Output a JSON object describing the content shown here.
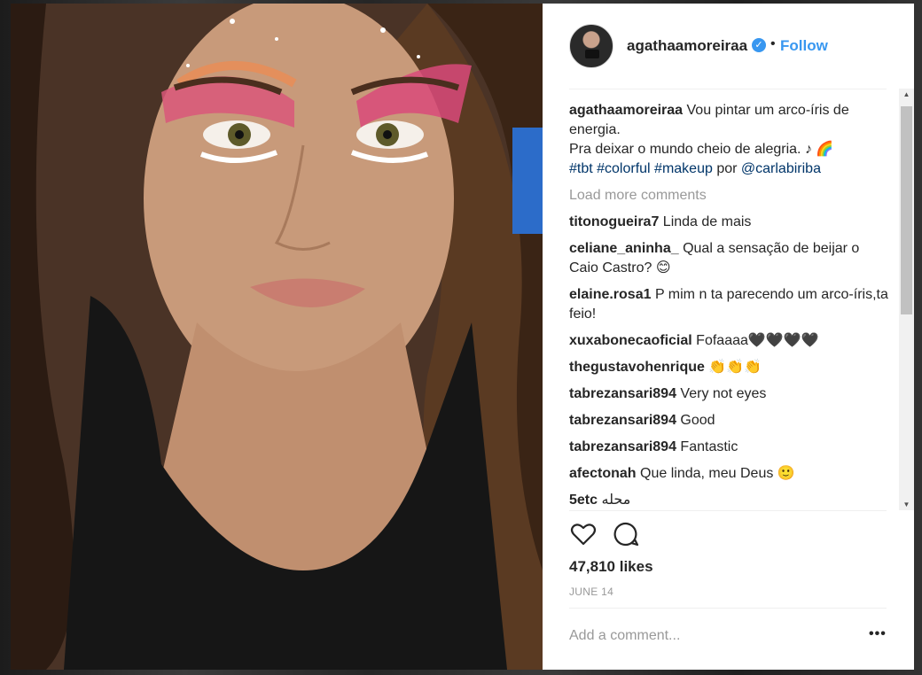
{
  "post": {
    "username": "agathaamoreiraa",
    "follow_label": "Follow",
    "separator_dot": "•",
    "caption": {
      "username": "agathaamoreiraa",
      "line1": "Vou pintar um arco-íris de energia.",
      "line2": "Pra deixar o mundo cheio de alegria. ♪ 🌈",
      "hashtags": "#tbt #colorful #makeup",
      "por": "por",
      "mention": "@carlabiriba"
    },
    "load_more": "Load more comments",
    "comments": [
      {
        "user": "titonogueira7",
        "text": "Linda de mais"
      },
      {
        "user": "celiane_aninha_",
        "text": "Qual a sensação de beijar o Caio Castro? 😊"
      },
      {
        "user": "elaine.rosa1",
        "text": "P mim n ta parecendo um arco-íris,ta feio!"
      },
      {
        "user": "xuxabonecaoficial",
        "text": "Fofaaaa🖤🖤🖤🖤"
      },
      {
        "user": "thegustavohenrique",
        "text": "👏👏👏"
      },
      {
        "user": "tabrezansari894",
        "text": "Very not eyes"
      },
      {
        "user": "tabrezansari894",
        "text": "Good"
      },
      {
        "user": "tabrezansari894",
        "text": "Fantastic"
      },
      {
        "user": "afectonah",
        "text": "Que linda, meu Deus 🙂"
      },
      {
        "user": "5etc",
        "text": "محله"
      }
    ],
    "likes": "47,810 likes",
    "date": "JUNE 14",
    "add_comment_placeholder": "Add a comment...",
    "more_label": "•••"
  },
  "icons": [
    "verified-badge-icon",
    "heart-icon",
    "comment-icon",
    "more-options-icon"
  ],
  "colors": {
    "link": "#3897f0",
    "hashtag": "#003569",
    "muted": "#999999",
    "text": "#262626"
  }
}
